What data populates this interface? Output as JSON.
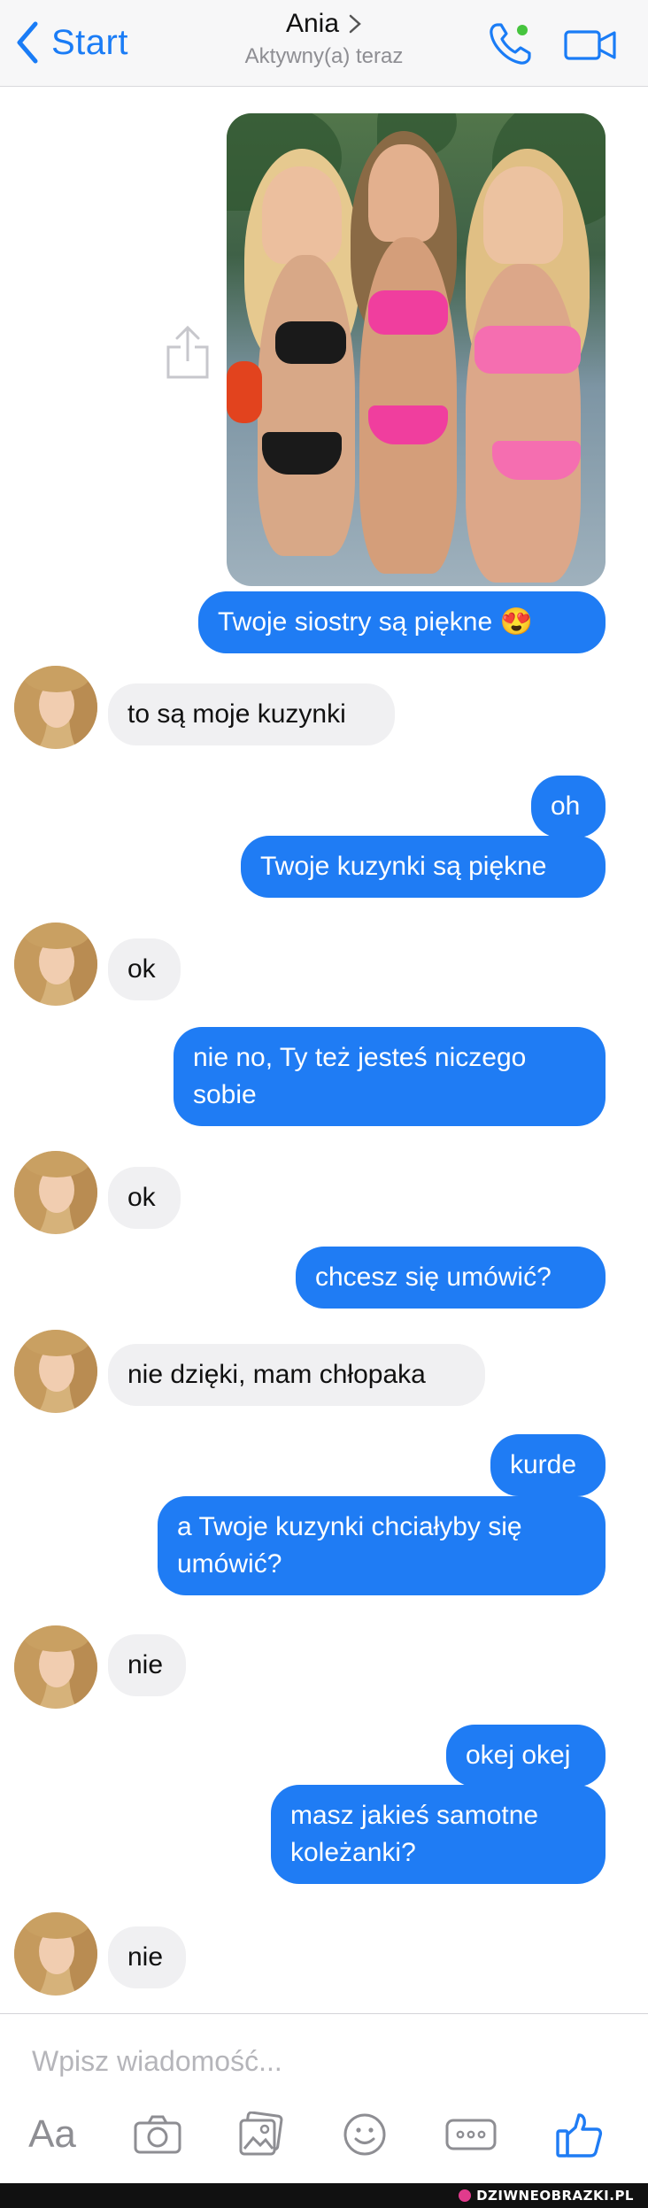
{
  "header": {
    "back_label": "Start",
    "contact_name": "Ania",
    "status": "Aktywny(a) teraz",
    "online_color": "#46c43e",
    "icons": [
      "chevron-left-icon",
      "chevron-right-icon",
      "phone-icon",
      "video-camera-icon"
    ]
  },
  "messages": [
    {
      "side": "out",
      "text": "Twoje siostry są piękne 😍"
    },
    {
      "side": "in",
      "text": "to są moje kuzynki"
    },
    {
      "side": "out",
      "text": "oh"
    },
    {
      "side": "out",
      "text": "Twoje kuzynki są piękne"
    },
    {
      "side": "in",
      "text": "ok"
    },
    {
      "side": "out",
      "text": "nie no, Ty też jesteś niczego\nsobie"
    },
    {
      "side": "in",
      "text": "ok"
    },
    {
      "side": "out",
      "text": "chcesz się umówić?"
    },
    {
      "side": "in",
      "text": "nie dzięki, mam chłopaka"
    },
    {
      "side": "out",
      "text": "kurde"
    },
    {
      "side": "out",
      "text": "a Twoje kuzynki chciałyby się\numówić?"
    },
    {
      "side": "in",
      "text": "nie"
    },
    {
      "side": "out",
      "text": "okej okej"
    },
    {
      "side": "out",
      "text": "masz jakieś samotne\nkoleżanki?"
    },
    {
      "side": "in",
      "text": "nie"
    }
  ],
  "composer": {
    "placeholder": "Wpisz wiadomość...",
    "aa_label": "Aa",
    "icons": [
      "camera-icon",
      "gallery-icon",
      "emoji-icon",
      "more-icon",
      "thumbs-up-icon"
    ]
  },
  "colors": {
    "accent": "#1f7cf4",
    "incoming_bubble": "#f0f0f2"
  },
  "watermark": "DZIWNEOBRAZKI.PL"
}
